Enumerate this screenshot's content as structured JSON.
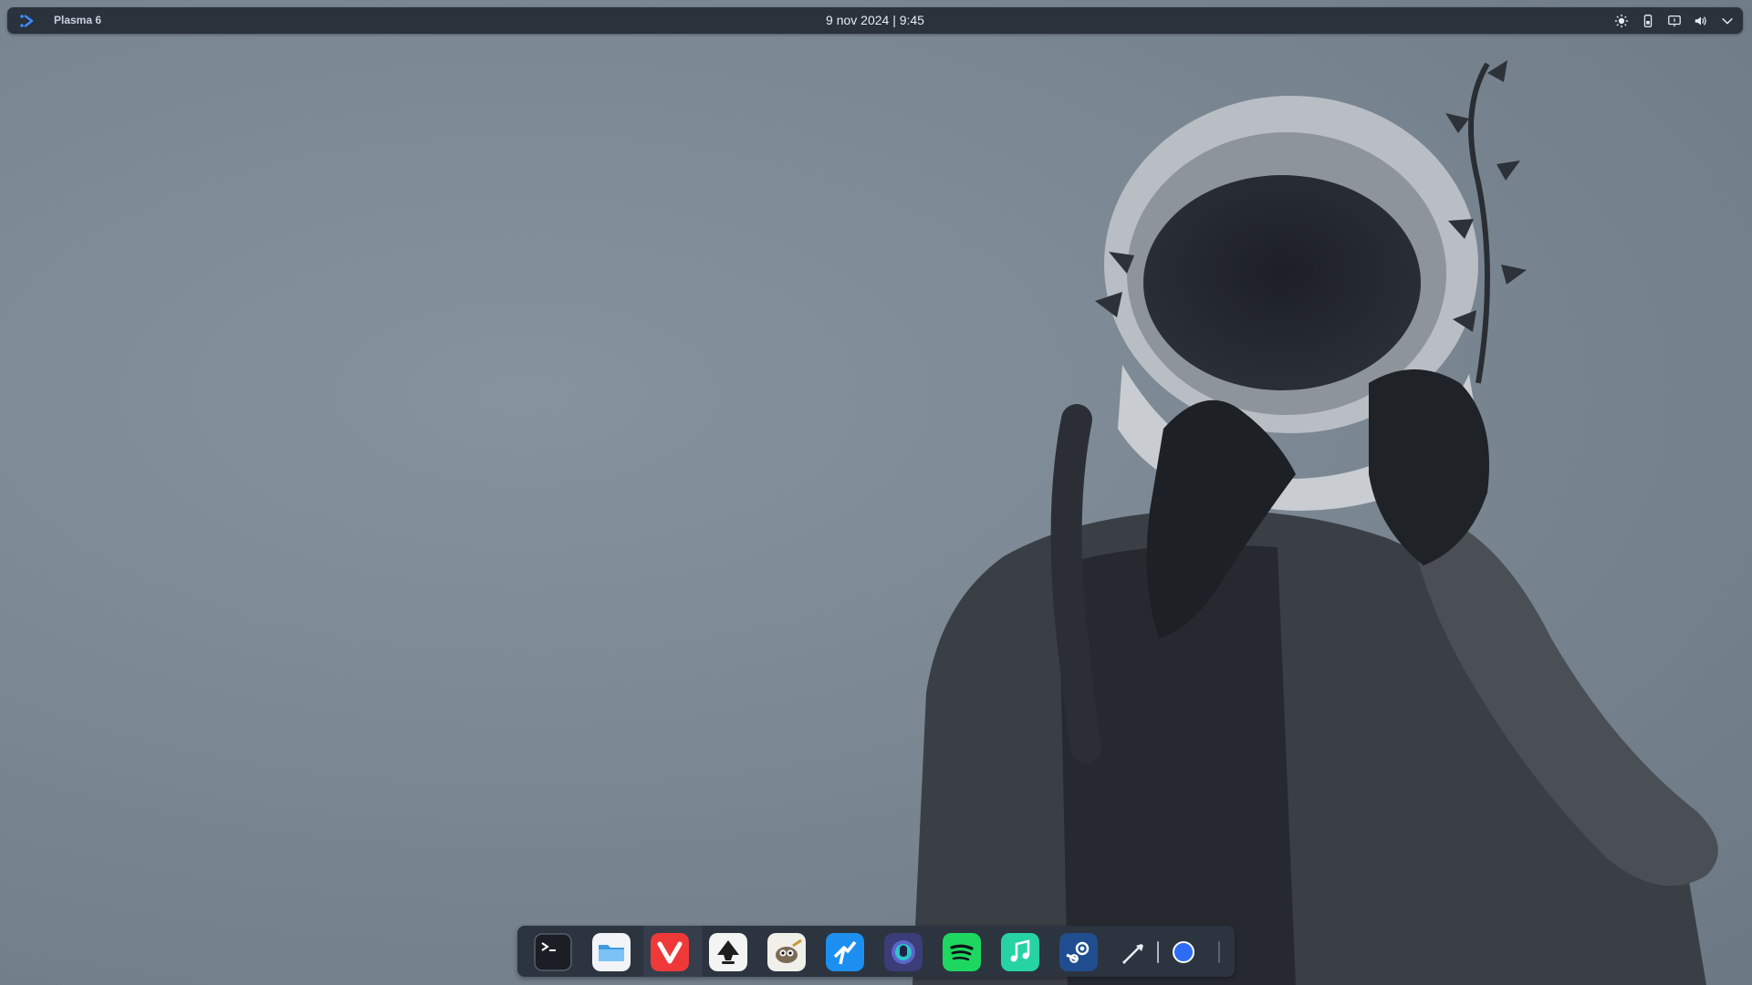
{
  "top_panel": {
    "title": "Plasma 6",
    "clock": "9 nov 2024 | 9:45",
    "launcher_icon": "plasma-launcher-icon",
    "tray": [
      {
        "name": "brightness-icon"
      },
      {
        "name": "battery-icon"
      },
      {
        "name": "display-icon"
      },
      {
        "name": "volume-icon"
      },
      {
        "name": "expand-tray-chevron-icon"
      }
    ]
  },
  "dock": {
    "apps": [
      {
        "name": "terminal-icon"
      },
      {
        "name": "files-icon"
      },
      {
        "name": "vivaldi-icon"
      },
      {
        "name": "inkscape-icon"
      },
      {
        "name": "gimp-icon"
      },
      {
        "name": "kdeconnect-icon"
      },
      {
        "name": "gitkraken-icon"
      },
      {
        "name": "spotify-icon"
      },
      {
        "name": "music-icon"
      },
      {
        "name": "steam-icon"
      },
      {
        "name": "color-picker-icon"
      },
      {
        "name": "blue-circle-icon"
      }
    ]
  },
  "colors": {
    "panel_bg": "#2a323c",
    "dock_bg": "#2c3440",
    "wallpaper": "#7d8a95"
  }
}
